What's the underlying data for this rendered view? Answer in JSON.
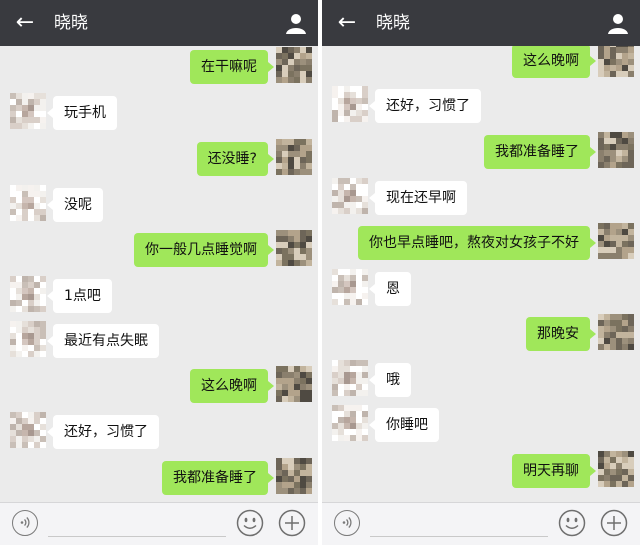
{
  "colors": {
    "topbar": "#393a3f",
    "chat_bg": "#ebebeb",
    "outgoing_bubble": "#a0e75a",
    "incoming_bubble": "#ffffff",
    "bottombar": "#f4f4f6"
  },
  "left": {
    "header": {
      "title": "晓晓",
      "back_icon": "back-arrow-icon",
      "profile_icon": "person-icon"
    },
    "messages": [
      {
        "dir": "out",
        "text": "在干嘛呢"
      },
      {
        "dir": "in",
        "text": "玩手机"
      },
      {
        "dir": "out",
        "text": "还没睡?"
      },
      {
        "dir": "in",
        "text": "没呢"
      },
      {
        "dir": "out",
        "text": "你一般几点睡觉啊"
      },
      {
        "dir": "in",
        "text": "1点吧"
      },
      {
        "dir": "in",
        "text": "最近有点失眠"
      },
      {
        "dir": "out",
        "text": "这么晚啊"
      },
      {
        "dir": "in",
        "text": "还好，习惯了"
      },
      {
        "dir": "out",
        "text": "我都准备睡了"
      }
    ]
  },
  "right": {
    "header": {
      "title": "晓晓",
      "back_icon": "back-arrow-icon",
      "profile_icon": "person-icon"
    },
    "messages": [
      {
        "dir": "out",
        "text": "这么晚啊"
      },
      {
        "dir": "in",
        "text": "还好，习惯了"
      },
      {
        "dir": "out",
        "text": "我都准备睡了"
      },
      {
        "dir": "in",
        "text": "现在还早啊"
      },
      {
        "dir": "out",
        "text": "你也早点睡吧，熬夜对女孩子不好"
      },
      {
        "dir": "in",
        "text": "恩"
      },
      {
        "dir": "out",
        "text": "那晚安"
      },
      {
        "dir": "in",
        "text": "哦"
      },
      {
        "dir": "in",
        "text": "你睡吧"
      },
      {
        "dir": "out",
        "text": "明天再聊"
      }
    ]
  }
}
